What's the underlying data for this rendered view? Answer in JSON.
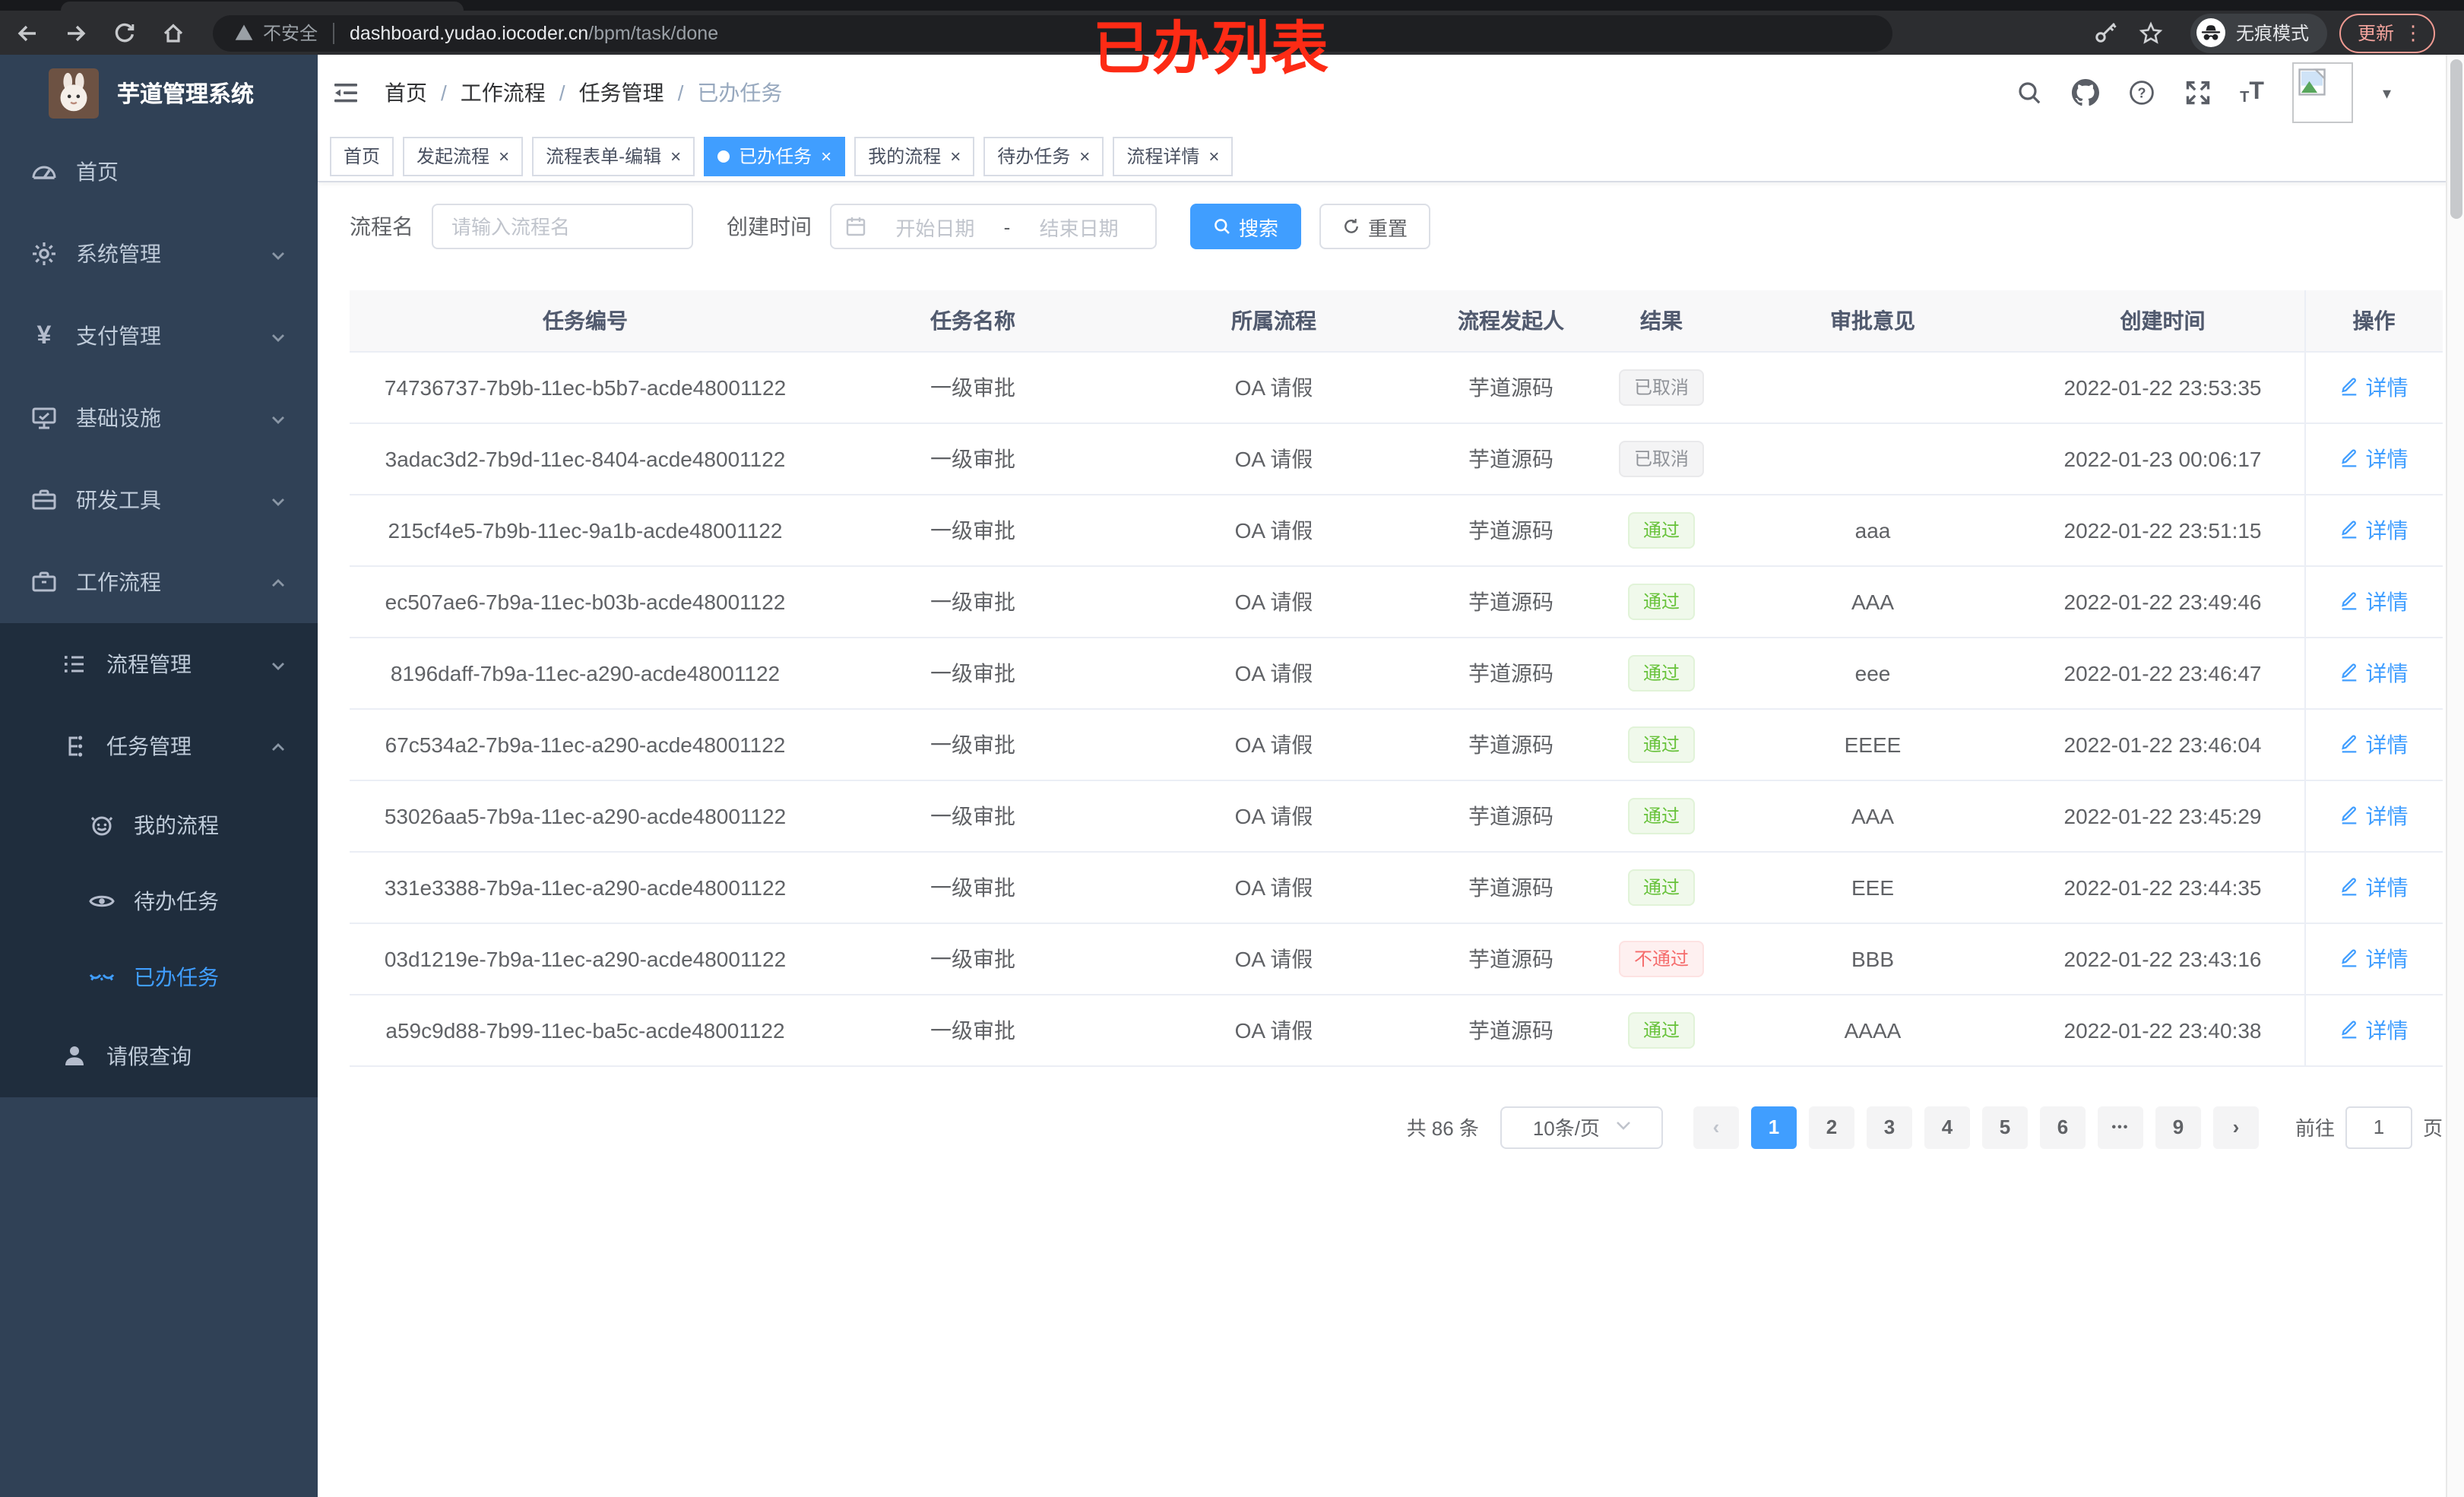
{
  "browser": {
    "security_text": "不安全",
    "url_host": "dashboard.yudao.iocoder.cn",
    "url_path": "/bpm/task/done",
    "incognito_label": "无痕模式",
    "update_label": "更新"
  },
  "annotation": "已办列表",
  "icons": {
    "close": "×",
    "more_vertical": "⋮",
    "caret_down": "▾",
    "prev": "‹",
    "next": "›",
    "ellipsis": "•••",
    "font_small": "T",
    "font_big": "T",
    "date_separator": "-"
  },
  "sidebar": {
    "title": "芋道管理系统",
    "items": [
      {
        "label": "首页"
      },
      {
        "label": "系统管理"
      },
      {
        "label": "支付管理"
      },
      {
        "label": "基础设施"
      },
      {
        "label": "研发工具"
      },
      {
        "label": "工作流程"
      },
      {
        "label": "流程管理"
      },
      {
        "label": "任务管理"
      },
      {
        "label": "我的流程"
      },
      {
        "label": "待办任务"
      },
      {
        "label": "已办任务"
      },
      {
        "label": "请假查询"
      }
    ]
  },
  "breadcrumb": [
    "首页",
    "工作流程",
    "任务管理",
    "已办任务"
  ],
  "tabs": [
    {
      "label": "首页"
    },
    {
      "label": "发起流程"
    },
    {
      "label": "流程表单-编辑"
    },
    {
      "label": "已办任务"
    },
    {
      "label": "我的流程"
    },
    {
      "label": "待办任务"
    },
    {
      "label": "流程详情"
    }
  ],
  "filters": {
    "name_label": "流程名",
    "name_placeholder": "请输入流程名",
    "time_label": "创建时间",
    "date_start_placeholder": "开始日期",
    "date_end_placeholder": "结束日期",
    "search_label": "搜索",
    "reset_label": "重置"
  },
  "table": {
    "headers": [
      "任务编号",
      "任务名称",
      "所属流程",
      "流程发起人",
      "结果",
      "审批意见",
      "创建时间",
      "操作"
    ],
    "action_label": "详情",
    "rows": [
      {
        "id": "74736737-7b9b-11ec-b5b7-acde48001122",
        "name": "一级审批",
        "flow": "OA 请假",
        "starter": "芋道源码",
        "result": "已取消",
        "opinion": "",
        "time": "2022-01-22 23:53:35"
      },
      {
        "id": "3adac3d2-7b9d-11ec-8404-acde48001122",
        "name": "一级审批",
        "flow": "OA 请假",
        "starter": "芋道源码",
        "result": "已取消",
        "opinion": "",
        "time": "2022-01-23 00:06:17"
      },
      {
        "id": "215cf4e5-7b9b-11ec-9a1b-acde48001122",
        "name": "一级审批",
        "flow": "OA 请假",
        "starter": "芋道源码",
        "result": "通过",
        "opinion": "aaa",
        "time": "2022-01-22 23:51:15"
      },
      {
        "id": "ec507ae6-7b9a-11ec-b03b-acde48001122",
        "name": "一级审批",
        "flow": "OA 请假",
        "starter": "芋道源码",
        "result": "通过",
        "opinion": "AAA",
        "time": "2022-01-22 23:49:46"
      },
      {
        "id": "8196daff-7b9a-11ec-a290-acde48001122",
        "name": "一级审批",
        "flow": "OA 请假",
        "starter": "芋道源码",
        "result": "通过",
        "opinion": "eee",
        "time": "2022-01-22 23:46:47"
      },
      {
        "id": "67c534a2-7b9a-11ec-a290-acde48001122",
        "name": "一级审批",
        "flow": "OA 请假",
        "starter": "芋道源码",
        "result": "通过",
        "opinion": "EEEE",
        "time": "2022-01-22 23:46:04"
      },
      {
        "id": "53026aa5-7b9a-11ec-a290-acde48001122",
        "name": "一级审批",
        "flow": "OA 请假",
        "starter": "芋道源码",
        "result": "通过",
        "opinion": "AAA",
        "time": "2022-01-22 23:45:29"
      },
      {
        "id": "331e3388-7b9a-11ec-a290-acde48001122",
        "name": "一级审批",
        "flow": "OA 请假",
        "starter": "芋道源码",
        "result": "通过",
        "opinion": "EEE",
        "time": "2022-01-22 23:44:35"
      },
      {
        "id": "03d1219e-7b9a-11ec-a290-acde48001122",
        "name": "一级审批",
        "flow": "OA 请假",
        "starter": "芋道源码",
        "result": "不通过",
        "opinion": "BBB",
        "time": "2022-01-22 23:43:16"
      },
      {
        "id": "a59c9d88-7b99-11ec-ba5c-acde48001122",
        "name": "一级审批",
        "flow": "OA 请假",
        "starter": "芋道源码",
        "result": "通过",
        "opinion": "AAAA",
        "time": "2022-01-22 23:40:38"
      }
    ]
  },
  "pagination": {
    "total_label": "共 86 条",
    "page_size_label": "10条/页",
    "pages": [
      "1",
      "2",
      "3",
      "4",
      "5",
      "6"
    ],
    "last_page": "9",
    "goto_label": "前往",
    "goto_suffix": "页",
    "jumper_value": "1"
  },
  "colors": {
    "accent": "#409eff",
    "success": "#67c23a",
    "danger": "#f56c6c",
    "info": "#909399",
    "sidebar_bg": "#304156",
    "submenu_bg": "#1f2d3d",
    "annotation_red": "#fd2b15"
  }
}
